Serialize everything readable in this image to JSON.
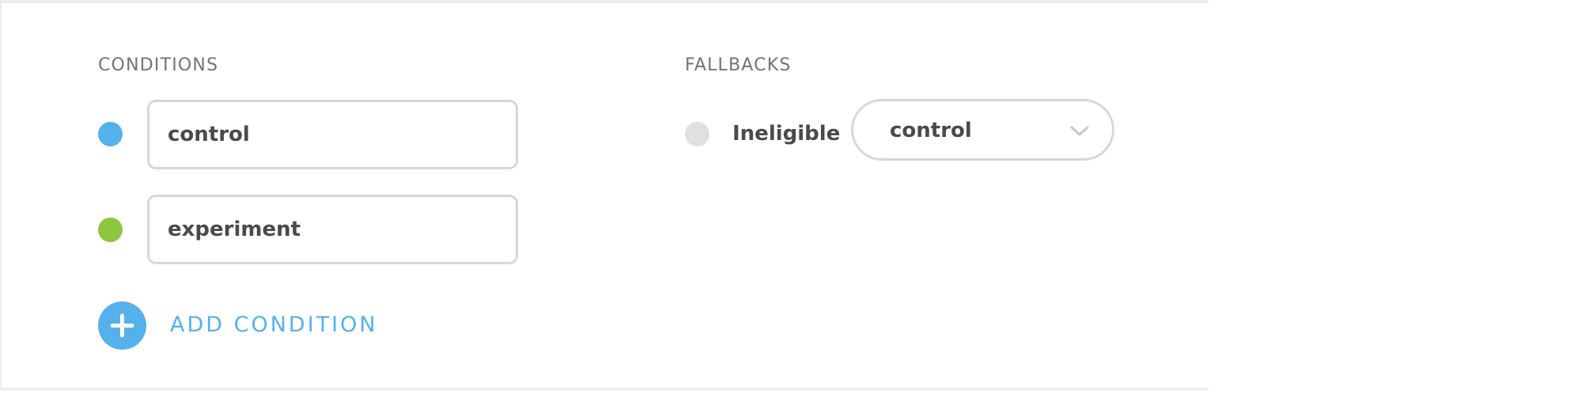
{
  "conditions": {
    "title": "CONDITIONS",
    "items": [
      {
        "value": "control",
        "color": "#55b1ec"
      },
      {
        "value": "experiment",
        "color": "#8cc63f"
      }
    ],
    "add_label": "ADD CONDITION",
    "add_icon": "plus-icon"
  },
  "fallbacks": {
    "title": "FALLBACKS",
    "items": [
      {
        "label": "Ineligible",
        "color": "#e0e0e0",
        "selected": "control",
        "icon": "chevron-down-icon"
      }
    ]
  },
  "colors": {
    "accent": "#55b1ec",
    "border": "#d7d7d7",
    "muted_text": "#737373",
    "text": "#4a4a4a"
  }
}
